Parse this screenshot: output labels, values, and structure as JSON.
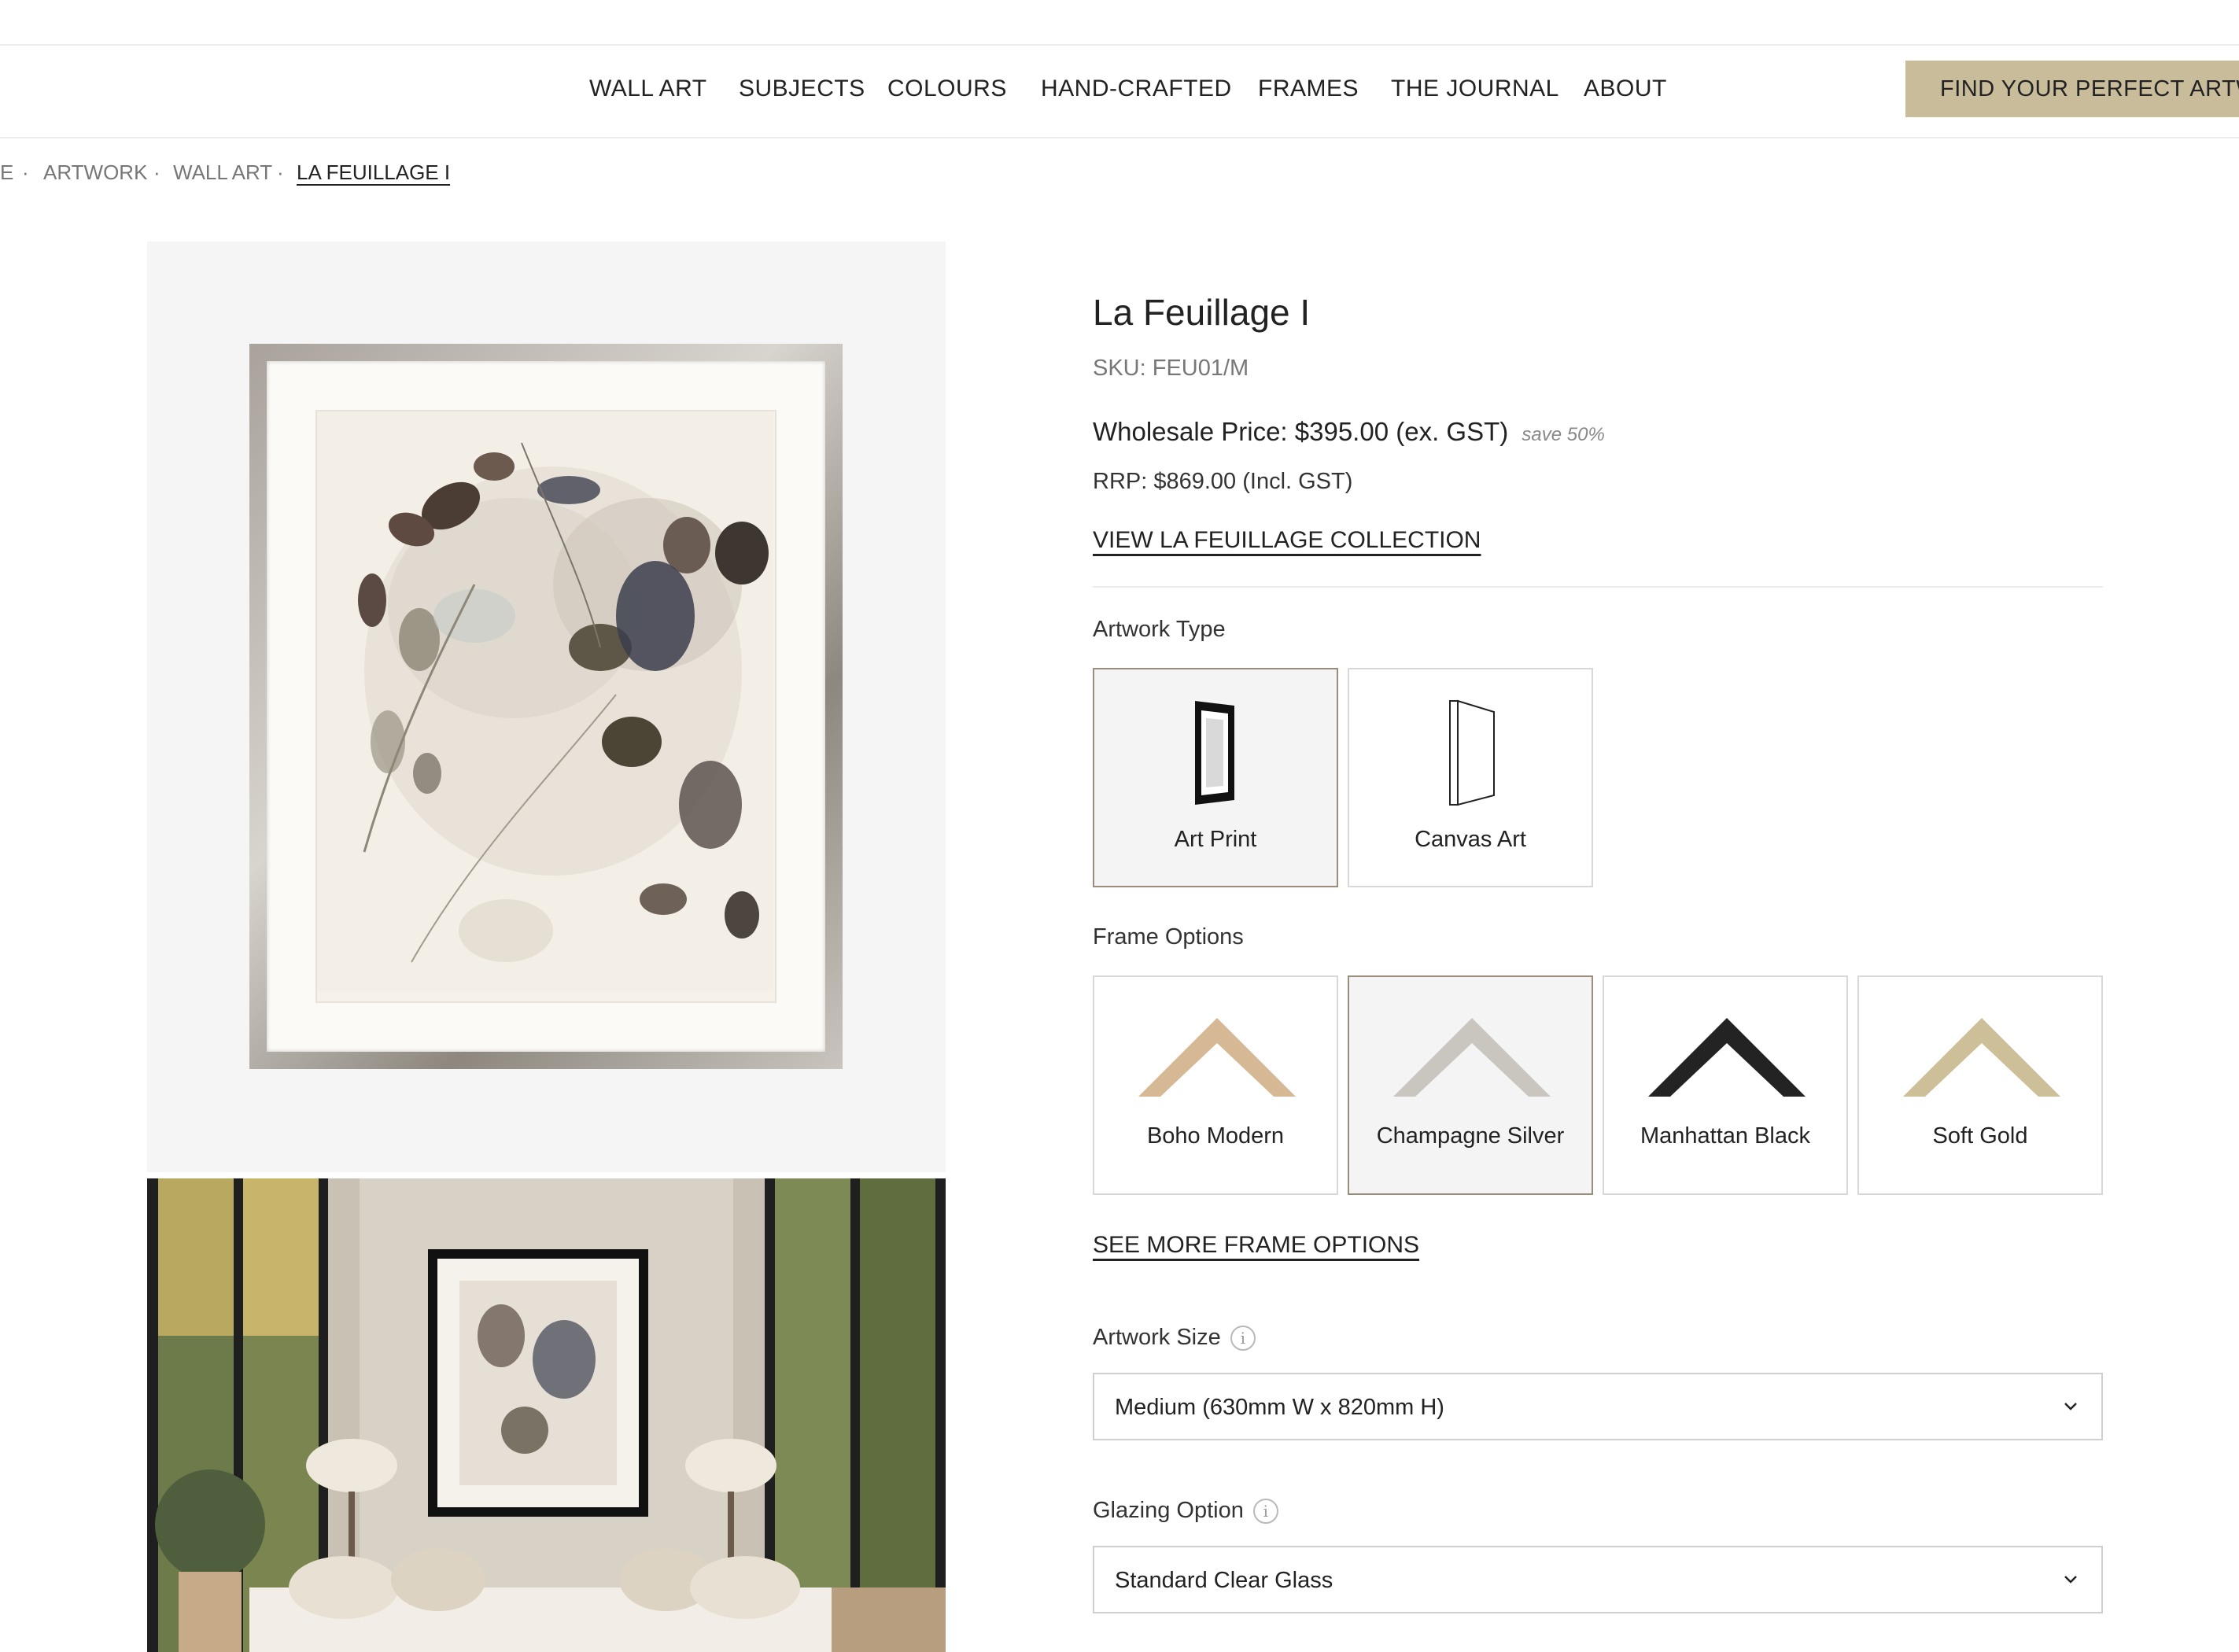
{
  "nav": {
    "items": [
      "WALL ART",
      "SUBJECTS",
      "COLOURS",
      "HAND-CRAFTED",
      "FRAMES",
      "THE JOURNAL",
      "ABOUT"
    ],
    "cta_label": "FIND YOUR PERFECT ARTWO"
  },
  "breadcrumb": {
    "items": [
      "E",
      "ARTWORK",
      "WALL ART",
      "LA FEUILLAGE I"
    ],
    "separator": "·"
  },
  "product": {
    "title": "La Feuillage I",
    "sku": "SKU: FEU01/M",
    "wholesale_price": "Wholesale Price: $395.00 (ex. GST)",
    "save": "save 50%",
    "rrp": "RRP: $869.00 (Incl. GST)",
    "collection_link": "VIEW LA FEUILLAGE COLLECTION"
  },
  "artwork_type": {
    "label": "Artwork Type",
    "options": [
      "Art Print",
      "Canvas Art"
    ],
    "selected": "Art Print"
  },
  "frame_options": {
    "label": "Frame Options",
    "options": [
      {
        "name": "Boho Modern",
        "color": "#d6b994"
      },
      {
        "name": "Champagne Silver",
        "color": "#c9c6bf"
      },
      {
        "name": "Manhattan Black",
        "color": "#232323"
      },
      {
        "name": "Soft Gold",
        "color": "#cdbf98"
      }
    ],
    "selected": "Champagne Silver",
    "see_more": "SEE MORE FRAME OPTIONS"
  },
  "artwork_size": {
    "label": "Artwork Size",
    "value": "Medium (630mm W x 820mm H)"
  },
  "glazing": {
    "label": "Glazing Option",
    "value": "Standard Clear Glass"
  },
  "icons": {
    "info": "info-icon",
    "chevron": "chevron-down-icon"
  }
}
